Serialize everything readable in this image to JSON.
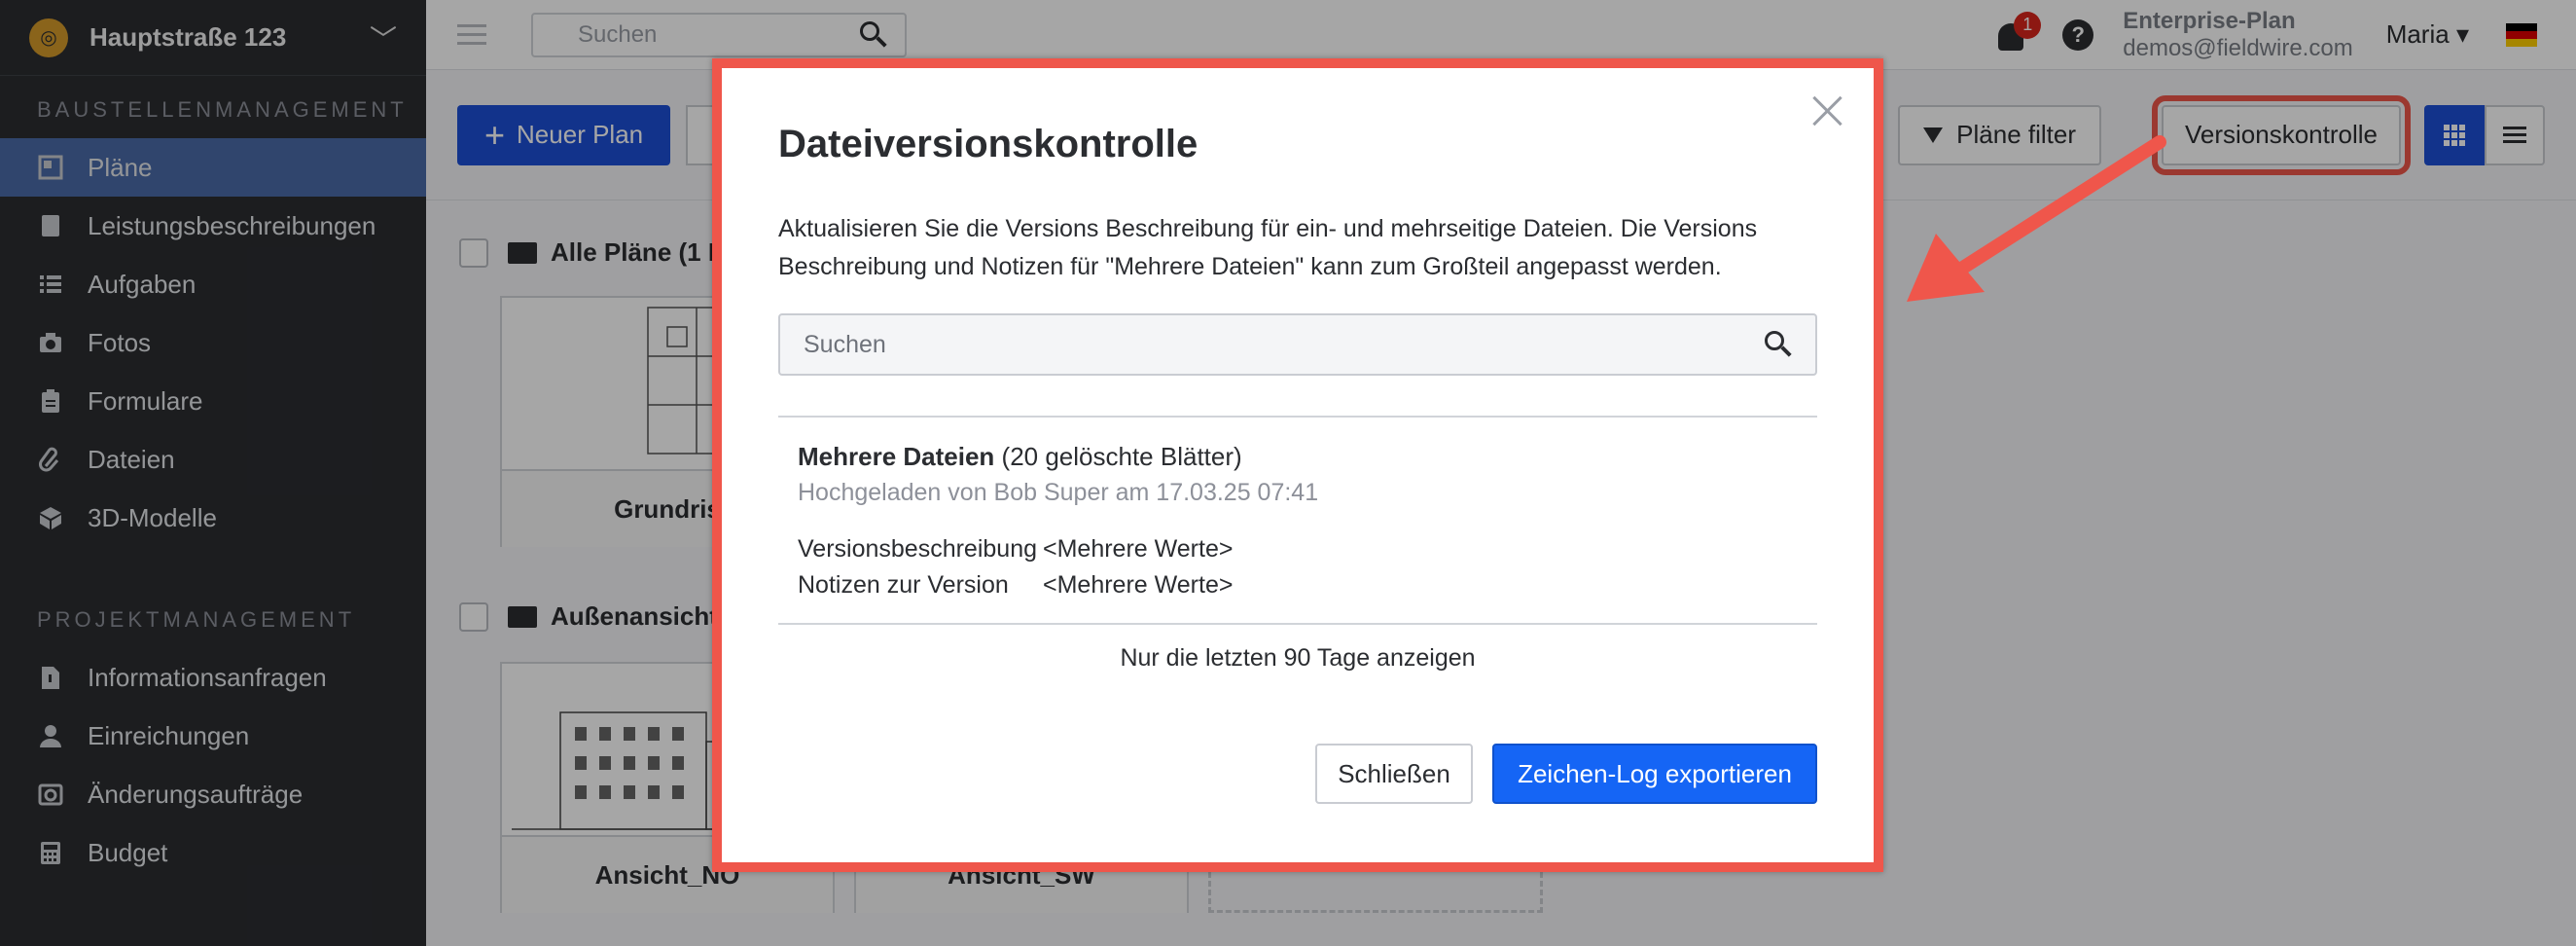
{
  "project": {
    "name": "Hauptstraße 123"
  },
  "sidebar": {
    "section1": "BAUSTELLENMANAGEMENT",
    "items1": [
      {
        "label": "Pläne",
        "icon": "plans-icon",
        "active": true
      },
      {
        "label": "Leistungsbeschreibungen",
        "icon": "specs-icon"
      },
      {
        "label": "Aufgaben",
        "icon": "tasks-icon"
      },
      {
        "label": "Fotos",
        "icon": "camera-icon"
      },
      {
        "label": "Formulare",
        "icon": "clipboard-icon"
      },
      {
        "label": "Dateien",
        "icon": "paperclip-icon"
      },
      {
        "label": "3D-Modelle",
        "icon": "cube-icon"
      }
    ],
    "section2": "PROJEKTMANAGEMENT",
    "items2": [
      {
        "label": "Informationsanfragen",
        "icon": "rfi-icon"
      },
      {
        "label": "Einreichungen",
        "icon": "person-icon"
      },
      {
        "label": "Änderungsaufträge",
        "icon": "change-order-icon"
      },
      {
        "label": "Budget",
        "icon": "calculator-icon"
      }
    ]
  },
  "topbar": {
    "search_placeholder": "Suchen",
    "notifications_count": "1",
    "plan_name": "Enterprise-Plan",
    "email": "demos@fieldwire.com",
    "user": "Maria",
    "user_chevron": "▾"
  },
  "toolbar": {
    "new_plan": "Neuer Plan",
    "filter": "Pläne filter",
    "version_control": "Versionskontrolle"
  },
  "content": {
    "folder1": "Alle Pläne (1 P",
    "folder2": "Außenansichte",
    "cards1": [
      "Grundris"
    ],
    "cards2": [
      "Ansicht_NO",
      "Ansicht_SW"
    ]
  },
  "modal": {
    "title": "Dateiversionskontrolle",
    "description": "Aktualisieren Sie die Versions Beschreibung für ein- und mehrseitige Dateien. Die Versions Beschreibung und Notizen für \"Mehrere Dateien\" kann zum Großteil angepasst werden.",
    "search_placeholder": "Suchen",
    "entry": {
      "name": "Mehrere Dateien",
      "detail": " (20 gelöschte Blätter)",
      "uploaded": "Hochgeladen von Bob Super am 17.03.25 07:41",
      "desc_label": "Versionsbeschreibung",
      "desc_value": "<Mehrere Werte>",
      "notes_label": "Notizen zur Version",
      "notes_value": "<Mehrere Werte>"
    },
    "last90": "Nur die letzten 90 Tage anzeigen",
    "close": "Schließen",
    "export": "Zeichen-Log exportieren"
  },
  "colors": {
    "accent": "#1d4fd6",
    "highlight": "#ef564b",
    "sidebar": "#2b2d31",
    "active_nav": "#4b6ba8"
  }
}
